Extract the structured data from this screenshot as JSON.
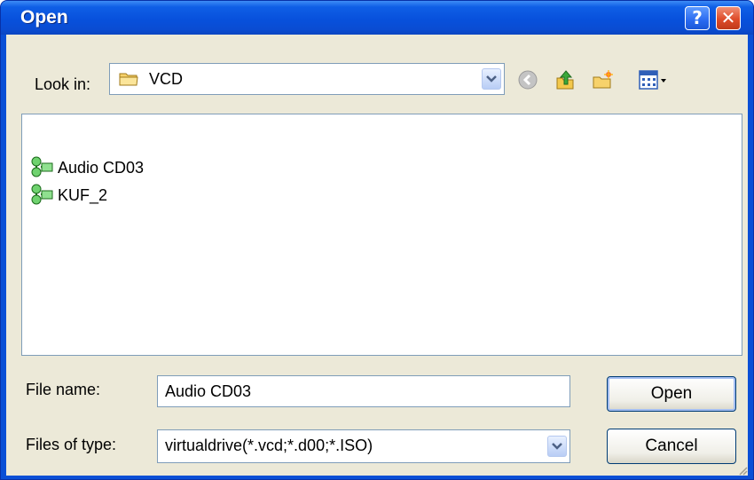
{
  "window": {
    "title": "Open"
  },
  "titlebar": {
    "help_glyph": "?",
    "close_glyph": "✕"
  },
  "lookin": {
    "label": "Look in:",
    "value": "VCD",
    "icon": "folder-icon"
  },
  "toolbar": [
    {
      "name": "back-icon"
    },
    {
      "name": "up-folder-icon"
    },
    {
      "name": "new-folder-icon"
    },
    {
      "name": "views-menu-icon"
    }
  ],
  "files": [
    {
      "name": "Audio CD03",
      "icon": "virtual-cd-icon"
    },
    {
      "name": "KUF_2",
      "icon": "virtual-cd-icon"
    }
  ],
  "filename": {
    "label": "File name:",
    "value": "Audio CD03"
  },
  "filetype": {
    "label": "Files of type:",
    "value": "virtualdrive(*.vcd;*.d00;*.ISO)"
  },
  "buttons": {
    "open": "Open",
    "cancel": "Cancel"
  },
  "colors": {
    "titlebar": "#0a4fd6",
    "dialog_face": "#ece9d8",
    "border": "#7f9db9",
    "close": "#de4c2a"
  }
}
